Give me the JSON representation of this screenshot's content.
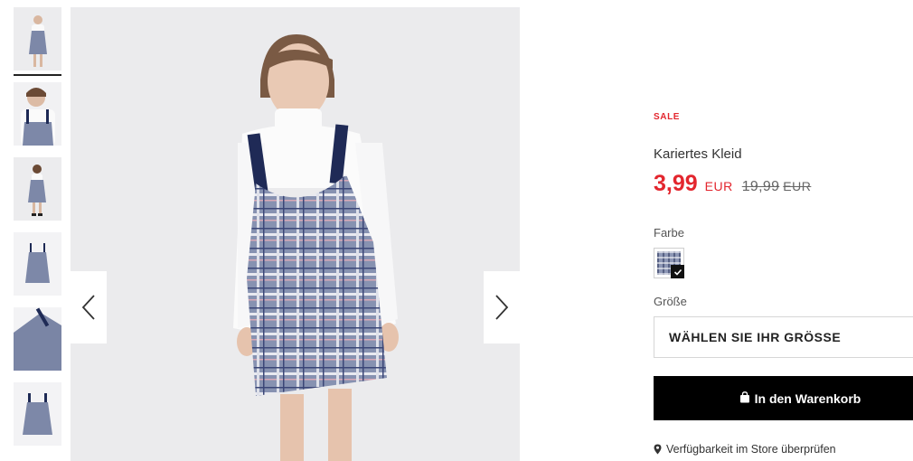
{
  "gallery": {
    "thumbnails": [
      {
        "name": "thumbnail-1",
        "active": true
      },
      {
        "name": "thumbnail-2",
        "active": false
      },
      {
        "name": "thumbnail-3",
        "active": false
      },
      {
        "name": "thumbnail-4",
        "active": false
      },
      {
        "name": "thumbnail-5",
        "active": false
      },
      {
        "name": "thumbnail-6",
        "active": false
      }
    ],
    "prev_icon": "chevron-left-icon",
    "next_icon": "chevron-right-icon"
  },
  "product": {
    "badge": "SALE",
    "title": "Kariertes Kleid",
    "price_now": "3,99",
    "currency": "EUR",
    "price_old": "19,99",
    "price_old_currency": "EUR"
  },
  "color": {
    "label": "Farbe",
    "selected_icon": "check-icon"
  },
  "size": {
    "label": "Größe",
    "placeholder": "WÄHLEN SIE IHR GRÖSSE"
  },
  "cart": {
    "icon": "shopping-bag-icon",
    "label": "In den Warenkorb"
  },
  "store": {
    "icon": "map-pin-icon",
    "label": "Verfügbarkeit im Store überprüfen"
  },
  "colors": {
    "sale_red": "#e3262e",
    "button_black": "#000000",
    "image_bg": "#ebebed"
  }
}
